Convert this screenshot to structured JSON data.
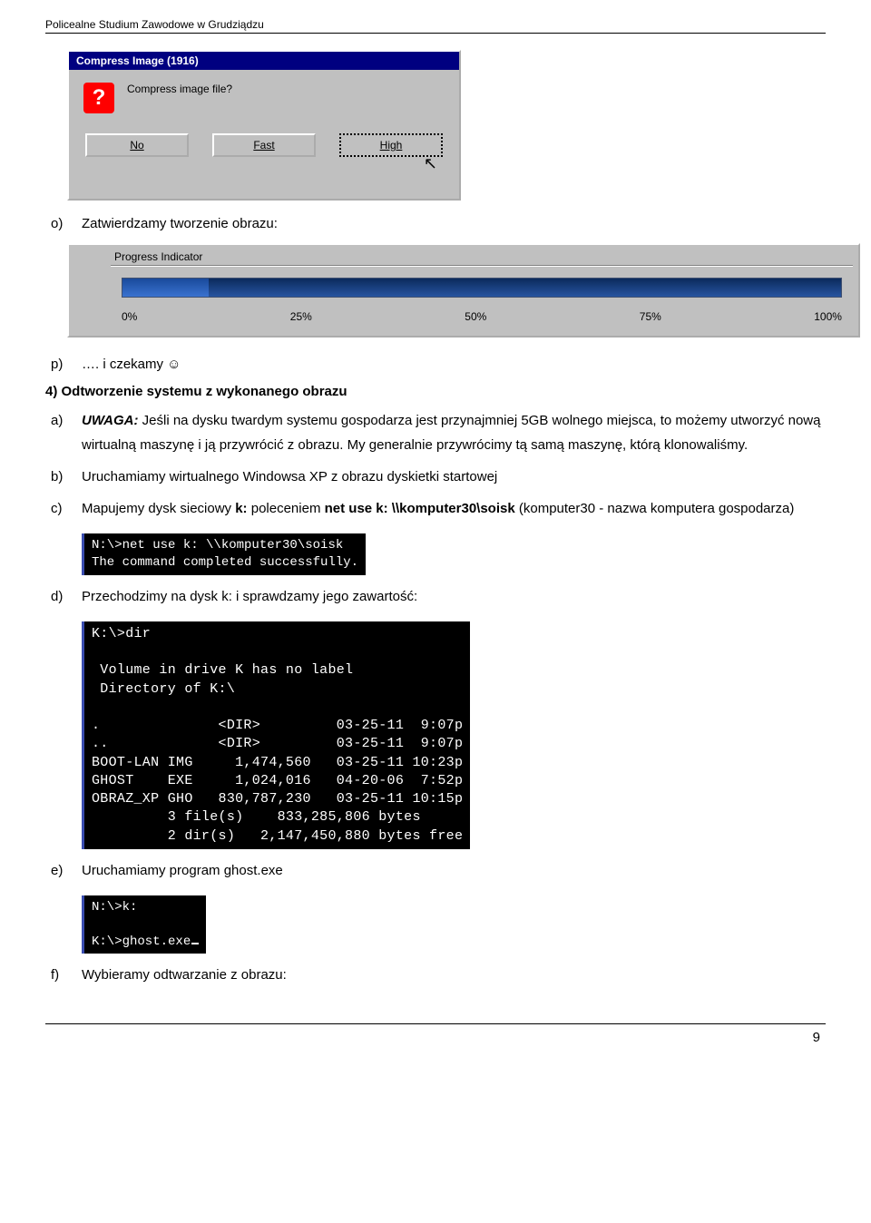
{
  "header": "Policealne Studium Zawodowe w Grudziądzu",
  "footer_page": "9",
  "dialog_compress": {
    "title": "Compress Image (1916)",
    "question": "Compress image file?",
    "buttons": {
      "no": "No",
      "fast": "Fast",
      "high": "High"
    }
  },
  "list_o": {
    "marker": "o)",
    "text": "Zatwierdzamy tworzenie obrazu:"
  },
  "progress": {
    "title": "Progress Indicator",
    "ticks": [
      "0%",
      "25%",
      "50%",
      "75%",
      "100%"
    ]
  },
  "list_p": {
    "marker": "p)",
    "text": "…. i czekamy ☺"
  },
  "section4": {
    "title": "4) Odtworzenie systemu z wykonanego obrazu"
  },
  "list_a": {
    "marker": "a)",
    "uwaga_label": "UWAGA:",
    "text_after_uwaga": " Jeśli na dysku twardym systemu gospodarza jest przynajmniej 5GB wolnego miejsca, to możemy utworzyć nową wirtualną maszynę i ją przywrócić z obrazu. My generalnie przywrócimy tą samą maszynę, którą klonowaliśmy."
  },
  "list_b": {
    "marker": "b)",
    "text": "Uruchamiamy wirtualnego Windowsa XP z obrazu dyskietki startowej"
  },
  "list_c": {
    "marker": "c)",
    "pre": "Mapujemy dysk sieciowy ",
    "bold_k": "k:",
    "mid": " poleceniem ",
    "bold_cmd": "net use k: \\\\komputer30\\soisk",
    "post": " (komputer30 - nazwa komputera gospodarza)"
  },
  "console_netuse": "N:\\>net use k: \\\\komputer30\\soisk\nThe command completed successfully.",
  "list_d": {
    "marker": "d)",
    "text": "Przechodzimy na dysk k: i sprawdzamy jego zawartość:"
  },
  "console_dir": "K:\\>dir\n\n Volume in drive K has no label\n Directory of K:\\\n\n.              <DIR>         03-25-11  9:07p\n..             <DIR>         03-25-11  9:07p\nBOOT-LAN IMG     1,474,560   03-25-11 10:23p\nGHOST    EXE     1,024,016   04-20-06  7:52p\nOBRAZ_XP GHO   830,787,230   03-25-11 10:15p\n         3 file(s)    833,285,806 bytes\n         2 dir(s)   2,147,450,880 bytes free",
  "list_e": {
    "marker": "e)",
    "text": "Uruchamiamy program ghost.exe"
  },
  "console_ghost": "N:\\>k:\n\nK:\\>ghost.exe",
  "list_f": {
    "marker": "f)",
    "text": "Wybieramy odtwarzanie z obrazu:"
  }
}
